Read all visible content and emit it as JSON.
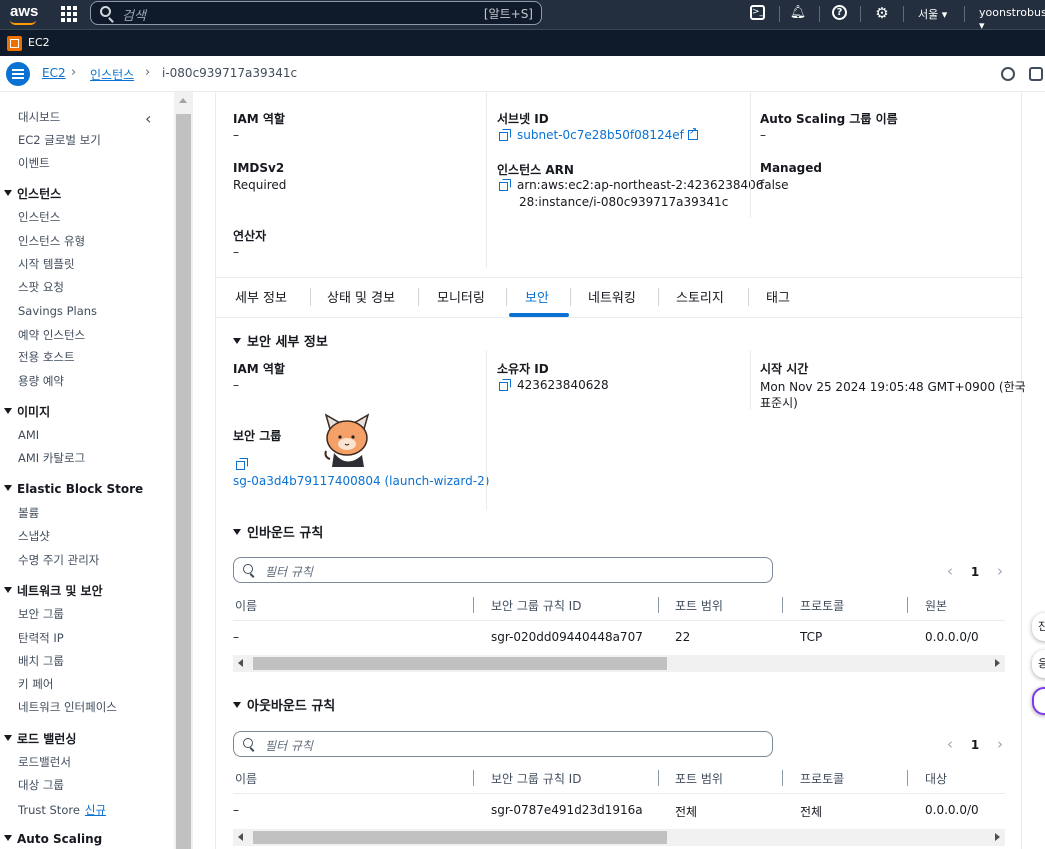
{
  "topnav": {
    "search_placeholder": "검색",
    "search_hint": "[알트+S]",
    "region": "서울 ▾",
    "account": "yoonstrobus ▾"
  },
  "service": {
    "label": "EC2"
  },
  "breadcrumb": {
    "items": [
      "EC2",
      "인스턴스",
      "i-080c939717a39341c"
    ]
  },
  "sidebar": {
    "top_items": [
      "대시보드",
      "EC2 글로벌 보기",
      "이벤트"
    ],
    "sections": [
      {
        "title": "인스턴스",
        "items": [
          "인스턴스",
          "인스턴스 유형",
          "시작 템플릿",
          "스팟 요청",
          "Savings Plans",
          "예약 인스턴스",
          "전용 호스트",
          "용량 예약"
        ]
      },
      {
        "title": "이미지",
        "items": [
          "AMI",
          "AMI 카탈로그"
        ]
      },
      {
        "title": "Elastic Block Store",
        "items": [
          "볼륨",
          "스냅샷",
          "수명 주기 관리자"
        ]
      },
      {
        "title": "네트워크 및 보안",
        "items": [
          "보안 그룹",
          "탄력적 IP",
          "배치 그룹",
          "키 페어",
          "네트워크 인터페이스"
        ]
      },
      {
        "title": "로드 밸런싱",
        "items": [
          "로드밸런서",
          "대상 그룹",
          "Trust Store"
        ]
      },
      {
        "title": "Auto Scaling",
        "items": []
      }
    ],
    "new_badge": "신규"
  },
  "details_top": {
    "iam_role_label": "IAM 역할",
    "iam_role_value": "–",
    "imdsv2_label": "IMDSv2",
    "imdsv2_value": "Required",
    "operator_label": "연산자",
    "operator_value": "–",
    "subnet_label": "서브넷 ID",
    "subnet_value": "subnet-0c7e28b50f08124ef",
    "arn_label": "인스턴스 ARN",
    "arn_line1": "arn:aws:ec2:ap-northeast-2:4236238406",
    "arn_line2": "28:instance/i-080c939717a39341c",
    "asg_label": "Auto Scaling 그룹 이름",
    "asg_value": "–",
    "managed_label": "Managed",
    "managed_value": "false"
  },
  "tabs": [
    "세부 정보",
    "상태 및 경보",
    "모니터링",
    "보안",
    "네트워킹",
    "스토리지",
    "태그"
  ],
  "security": {
    "heading": "보안 세부 정보",
    "iam_role_label": "IAM 역할",
    "iam_role_value": "–",
    "owner_label": "소유자 ID",
    "owner_value": "423623840628",
    "launch_label": "시작 시간",
    "launch_line1": "Mon Nov 25 2024 19:05:48 GMT+0900 (한국",
    "launch_line2": "표준시)",
    "sg_label": "보안 그룹",
    "sg_value": "sg-0a3d4b79117400804 (launch-wizard-2)"
  },
  "inbound": {
    "heading": "인바운드 규칙",
    "filter_placeholder": "필터 규칙",
    "page": "1",
    "columns": [
      "이름",
      "보안 그룹 규칙 ID",
      "포트 범위",
      "프로토콜",
      "원본"
    ],
    "row": [
      "–",
      "sgr-020dd09440448a707",
      "22",
      "TCP",
      "0.0.0.0/0"
    ]
  },
  "outbound": {
    "heading": "아웃바운드 규칙",
    "filter_placeholder": "필터 규칙",
    "page": "1",
    "columns": [
      "이름",
      "보안 그룹 규칙 ID",
      "포트 범위",
      "프로토콜",
      "대상"
    ],
    "row": [
      "–",
      "sgr-0787e491d23d1916a",
      "전체",
      "전체",
      "0.0.0.0/0"
    ]
  },
  "floating": [
    "진",
    "응"
  ],
  "colors": {
    "accent": "#0972d3",
    "nav_bg": "#232f3e",
    "ec2_orange": "#ed7100"
  }
}
